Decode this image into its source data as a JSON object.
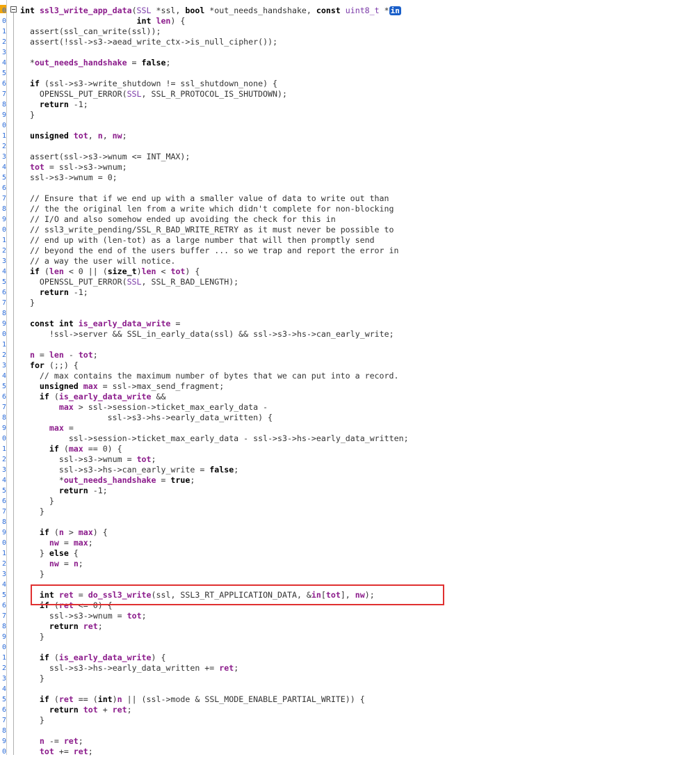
{
  "editor": {
    "badge": "in",
    "lines": [
      "int ssl3_write_app_data(SSL *ssl, bool *out_needs_handshake, const uint8_t *",
      "                        int len) {",
      "  assert(ssl_can_write(ssl));",
      "  assert(!ssl->s3->aead_write_ctx->is_null_cipher());",
      "",
      "  *out_needs_handshake = false;",
      "",
      "  if (ssl->s3->write_shutdown != ssl_shutdown_none) {",
      "    OPENSSL_PUT_ERROR(SSL, SSL_R_PROTOCOL_IS_SHUTDOWN);",
      "    return -1;",
      "  }",
      "",
      "  unsigned tot, n, nw;",
      "",
      "  assert(ssl->s3->wnum <= INT_MAX);",
      "  tot = ssl->s3->wnum;",
      "  ssl->s3->wnum = 0;",
      "",
      "  // Ensure that if we end up with a smaller value of data to write out than",
      "  // the the original len from a write which didn't complete for non-blocking",
      "  // I/O and also somehow ended up avoiding the check for this in",
      "  // ssl3_write_pending/SSL_R_BAD_WRITE_RETRY as it must never be possible to",
      "  // end up with (len-tot) as a large number that will then promptly send",
      "  // beyond the end of the users buffer ... so we trap and report the error in",
      "  // a way the user will notice.",
      "  if (len < 0 || (size_t)len < tot) {",
      "    OPENSSL_PUT_ERROR(SSL, SSL_R_BAD_LENGTH);",
      "    return -1;",
      "  }",
      "",
      "  const int is_early_data_write =",
      "      !ssl->server && SSL_in_early_data(ssl) && ssl->s3->hs->can_early_write;",
      "",
      "  n = len - tot;",
      "  for (;;) {",
      "    // max contains the maximum number of bytes that we can put into a record.",
      "    unsigned max = ssl->max_send_fragment;",
      "    if (is_early_data_write &&",
      "        max > ssl->session->ticket_max_early_data -",
      "                  ssl->s3->hs->early_data_written) {",
      "      max =",
      "          ssl->session->ticket_max_early_data - ssl->s3->hs->early_data_written;",
      "      if (max == 0) {",
      "        ssl->s3->wnum = tot;",
      "        ssl->s3->hs->can_early_write = false;",
      "        *out_needs_handshake = true;",
      "        return -1;",
      "      }",
      "    }",
      "",
      "    if (n > max) {",
      "      nw = max;",
      "    } else {",
      "      nw = n;",
      "    }",
      "",
      "    int ret = do_ssl3_write(ssl, SSL3_RT_APPLICATION_DATA, &in[tot], nw);",
      "    if (ret <= 0) {",
      "      ssl->s3->wnum = tot;",
      "      return ret;",
      "    }",
      "",
      "    if (is_early_data_write) {",
      "      ssl->s3->hs->early_data_written += ret;",
      "    }",
      "",
      "    if (ret == (int)n || (ssl->mode & SSL_MODE_ENABLE_PARTIAL_WRITE)) {",
      "      return tot + ret;",
      "    }",
      "",
      "    n -= ret;",
      "    tot += ret;"
    ],
    "line_numbers": [
      "0",
      "0",
      "1",
      "2",
      "3",
      "4",
      "5",
      "6",
      "7",
      "8",
      "9",
      "0",
      "1",
      "2",
      "3",
      "4",
      "5",
      "6",
      "7",
      "8",
      "9",
      "0",
      "1",
      "2",
      "3",
      "4",
      "5",
      "6",
      "7",
      "8",
      "9",
      "0",
      "1",
      "2",
      "3",
      "4",
      "5",
      "6",
      "7",
      "8",
      "9",
      "0",
      "1",
      "2",
      "3",
      "4",
      "5",
      "6",
      "7",
      "8",
      "9",
      "0",
      "1",
      "2",
      "3",
      "4",
      "5",
      "6",
      "7",
      "8",
      "9",
      "0",
      "1",
      "2",
      "3",
      "4",
      "5",
      "6",
      "7",
      "8",
      "9",
      "0"
    ],
    "highlight_color": "#e03030",
    "accent_color": "#1a5fc9"
  }
}
